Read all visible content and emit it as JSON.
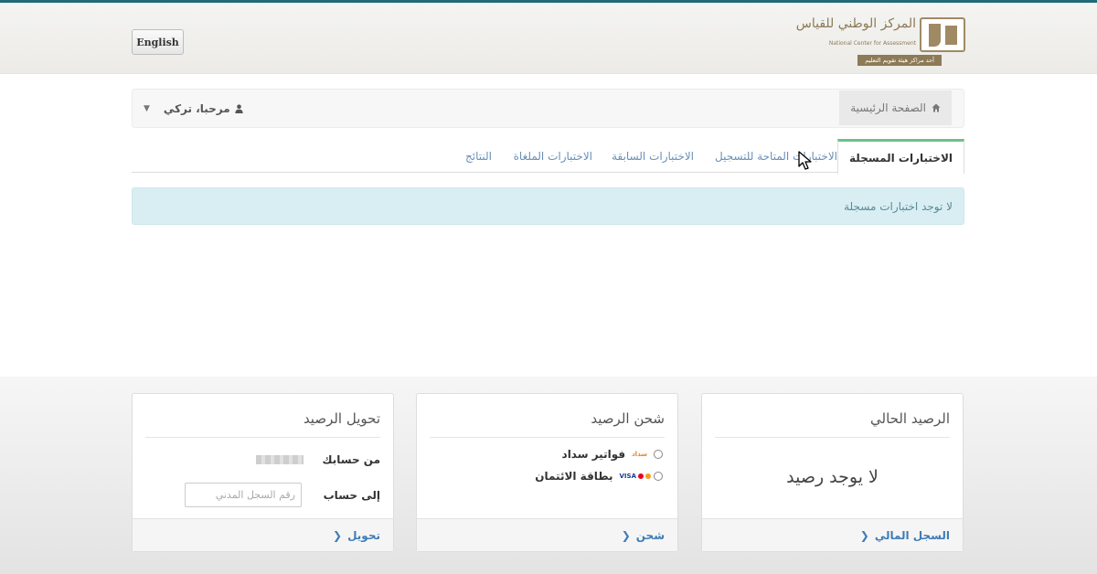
{
  "header": {
    "language_button": "English",
    "logo": {
      "arabic_name": "المركز الوطني للقياس",
      "english_name": "National Center for Assessment",
      "tagline": "أحد مراكز هيئة تقويم التعليم"
    }
  },
  "navbar": {
    "home_label": "الصفحة الرئيسية",
    "home_icon": "home-icon",
    "user_greeting": "مرحبا، تركي",
    "user_icon": "user-icon"
  },
  "tabs": [
    {
      "label": "الاختبارات المسجلة",
      "active": true
    },
    {
      "label": "الاختبارات المتاحة للتسجيل",
      "active": false
    },
    {
      "label": "الاختبارات السابقة",
      "active": false
    },
    {
      "label": "الاختبارات الملغاة",
      "active": false
    },
    {
      "label": "النتائج",
      "active": false
    }
  ],
  "alert": {
    "text": "لا توجد اختبارات مسجلة"
  },
  "panels": {
    "balance": {
      "title": "الرصيد الحالي",
      "value": "لا يوجد رصيد",
      "footer_link": "السجل المالي"
    },
    "recharge": {
      "title": "شحن الرصيد",
      "options": [
        {
          "label": "فواتير سداد",
          "logo_text": "سداد"
        },
        {
          "label": "بطاقة الائتمان",
          "logo_text": "VISA"
        }
      ],
      "footer_link": "شحن"
    },
    "transfer": {
      "title": "تحويل الرصيد",
      "from_label": "من حسابك",
      "to_label": "إلى حساب",
      "to_placeholder": "رقم السجل المدني",
      "footer_link": "تحويل"
    }
  },
  "colors": {
    "accent_green": "#6bc18a",
    "link_blue": "#3f7cb6",
    "alert_bg": "#d9eef3",
    "brand_gold": "#8d7a56"
  }
}
